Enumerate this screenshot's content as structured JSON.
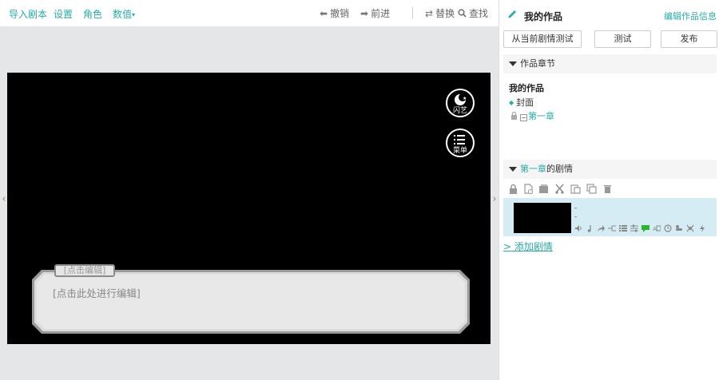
{
  "topbar": {
    "menu": [
      {
        "label": "导入剧本"
      },
      {
        "label": "设置"
      },
      {
        "label": "角色"
      },
      {
        "label": "数值"
      }
    ],
    "caret": "▾",
    "tools": {
      "undo": "撤销",
      "redo": "前进",
      "replace": "替换",
      "find": "查找"
    }
  },
  "stage": {
    "btn_flash_label": "闪艺",
    "btn_menu_label": "菜单",
    "dialog": {
      "name_placeholder": "[点击编辑]",
      "text_placeholder": "[点击此处进行编辑]"
    }
  },
  "panel": {
    "title": "我的作品",
    "edit_info": "编辑作品信息",
    "btn_test_from_current": "从当前剧情测试",
    "btn_test": "测试",
    "btn_publish": "发布",
    "chapters_header": "作品章节",
    "tree": {
      "root": "我的作品",
      "cover": "封面",
      "chapter1": "第一章"
    },
    "scene_header_chapter": "第一章",
    "scene_header_suffix": "的剧情",
    "scene_dash_1": "-",
    "scene_dash_2": "-",
    "add_scene": "> 添加剧情"
  },
  "colors": {
    "accent": "#27aca8",
    "stage_bg": "#000000",
    "selected_row": "#d6ecf5"
  }
}
